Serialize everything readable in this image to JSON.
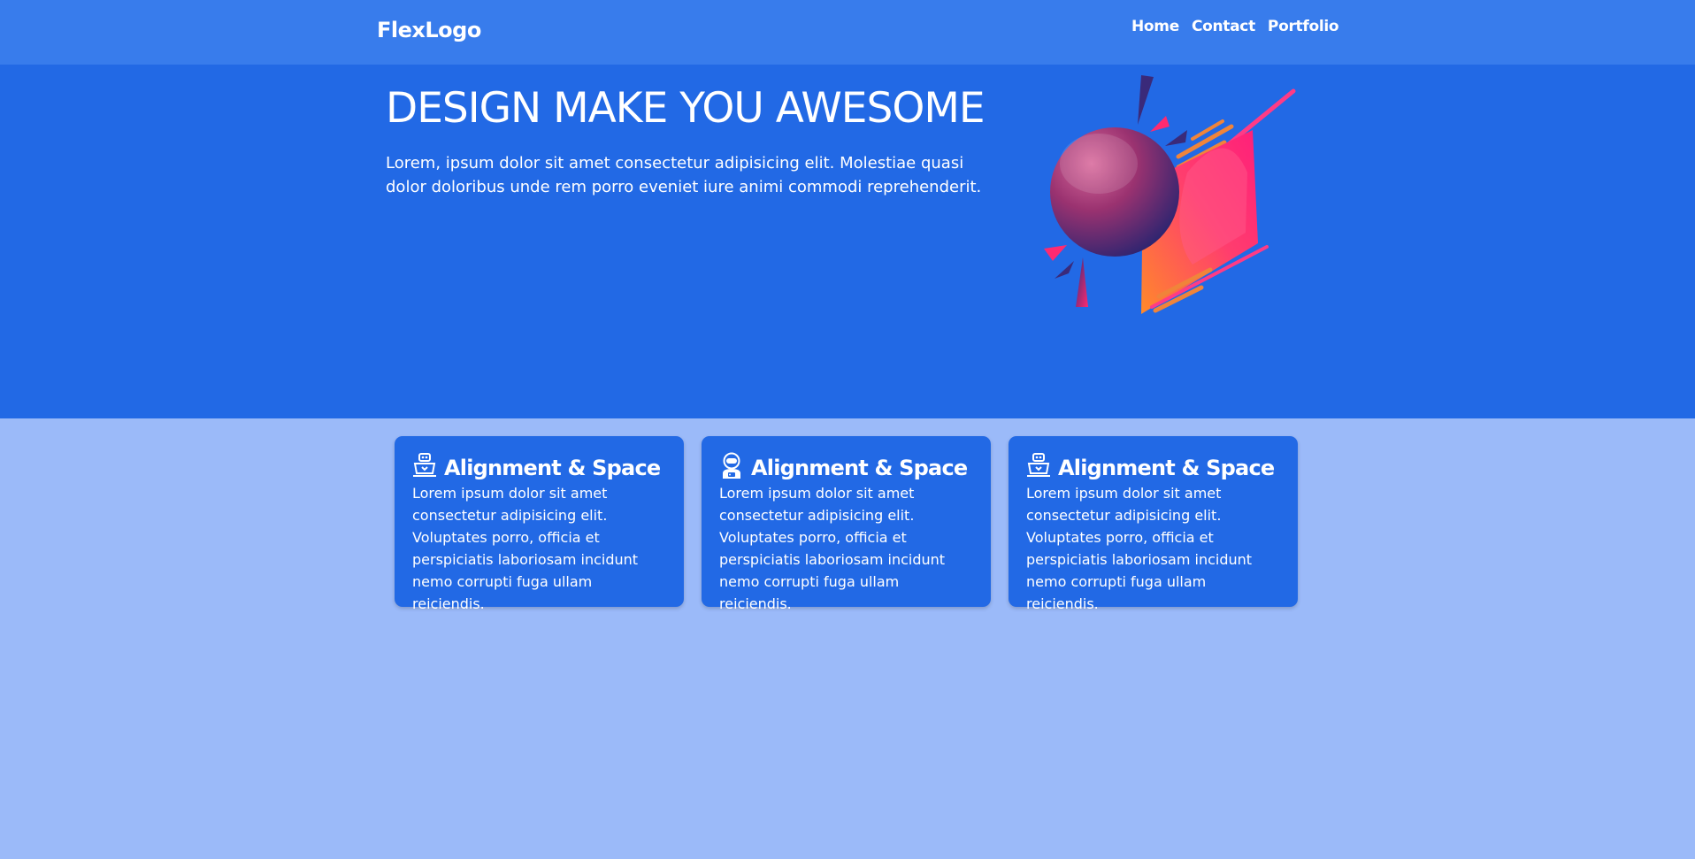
{
  "brand": {
    "logo_text": "FlexLogo"
  },
  "nav": {
    "links": [
      {
        "label": "Home"
      },
      {
        "label": "Contact"
      },
      {
        "label": "Portfolio"
      }
    ]
  },
  "hero": {
    "title": "DESIGN MAKE YOU AWESOME",
    "text": "Lorem, ipsum dolor sit amet consectetur adipisicing elit. Molestiae quasi dolor doloribus unde rem porro eveniet iure animi commodi reprehenderit.",
    "illustration": "abstract-sphere-illustration"
  },
  "cards": [
    {
      "icon": "robot-laptop-icon",
      "title": "Alignment & Space",
      "text": "Lorem ipsum dolor sit amet consectetur adipisicing elit. Voluptates porro, officia et perspiciatis laboriosam incidunt nemo corrupti fuga ullam reiciendis."
    },
    {
      "icon": "astronaut-icon",
      "title": "Alignment & Space",
      "text": "Lorem ipsum dolor sit amet consectetur adipisicing elit. Voluptates porro, officia et perspiciatis laboriosam incidunt nemo corrupti fuga ullam reiciendis."
    },
    {
      "icon": "robot-laptop-icon",
      "title": "Alignment & Space",
      "text": "Lorem ipsum dolor sit amet consectetur adipisicing elit. Voluptates porro, officia et perspiciatis laboriosam incidunt nemo corrupti fuga ullam reiciendis."
    }
  ],
  "colors": {
    "navbar": "#387cec",
    "hero": "#2269e5",
    "page_background": "#9bbaf9",
    "card": "#2269e5",
    "text": "#ffffff"
  }
}
